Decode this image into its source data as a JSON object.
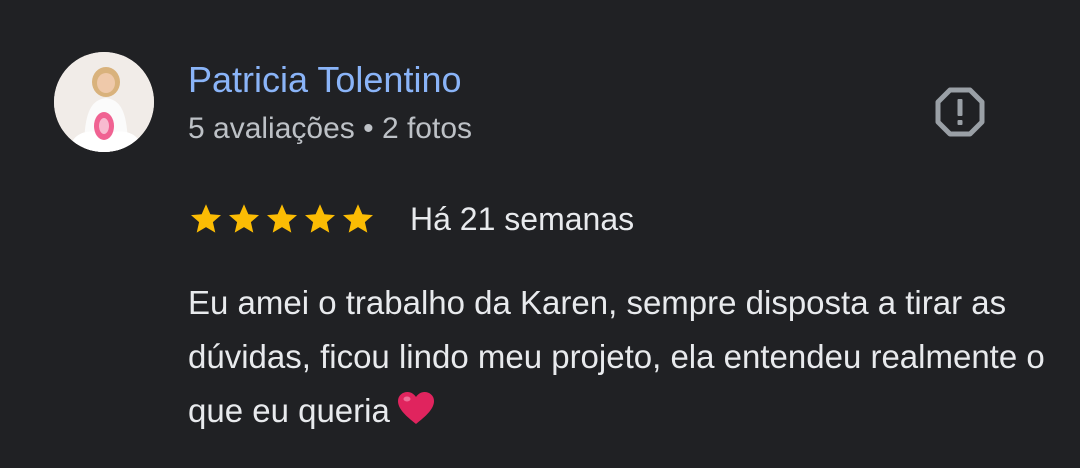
{
  "reviewer": {
    "name": "Patricia Tolentino",
    "meta": "5 avaliações • 2 fotos",
    "avatar_icon": "user-photo-avatar"
  },
  "report": {
    "icon": "report-octagon-icon"
  },
  "rating": {
    "stars": 5,
    "max_stars": 5,
    "star_color": "#fbbc04",
    "date": "Há 21 semanas"
  },
  "review": {
    "text": "Eu amei o trabalho da Karen, sempre disposta a tirar as dúvidas, ficou lindo meu projeto, ela entendeu realmente o que eu queria",
    "emoji_icon": "red-heart-icon"
  },
  "colors": {
    "background": "#202124",
    "name": "#8ab4f8",
    "meta": "#bdc1c6",
    "text": "#e8eaed",
    "icon": "#9aa0a6",
    "heart": "#e0245e"
  }
}
